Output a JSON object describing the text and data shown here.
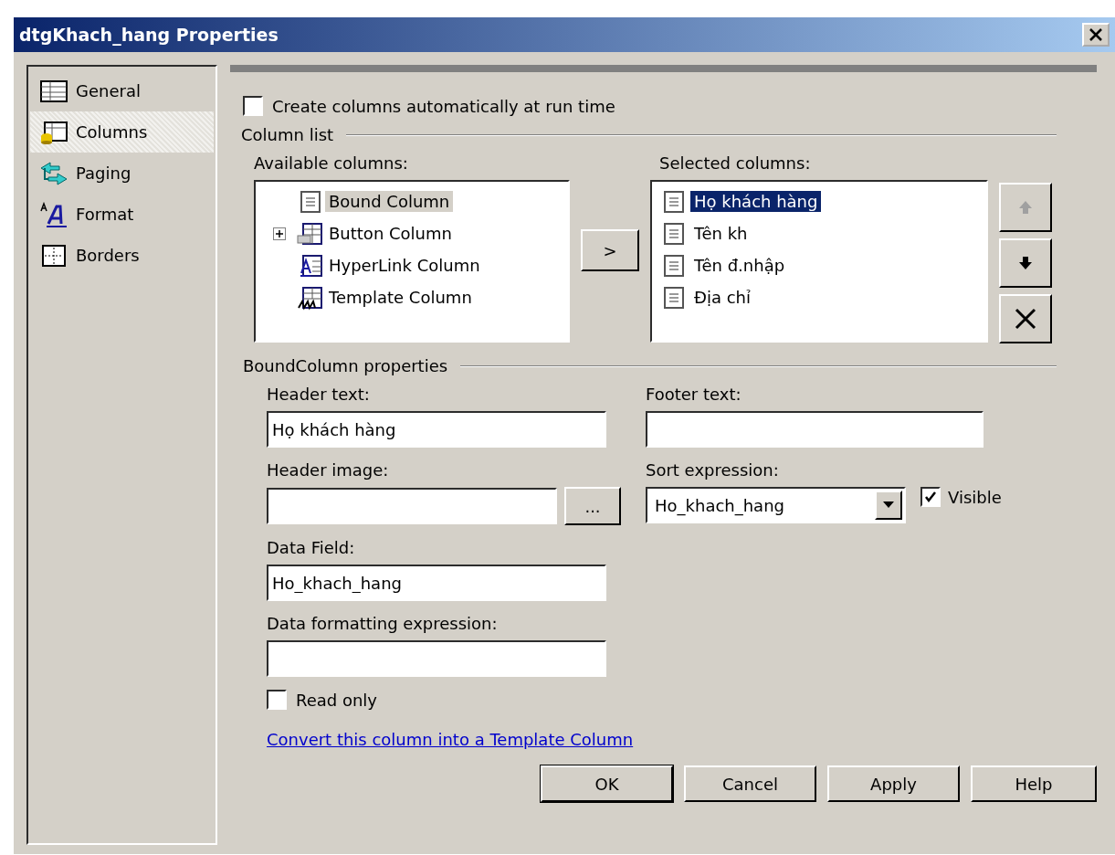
{
  "window": {
    "title": "dtgKhach_hang Properties"
  },
  "sidebar": {
    "items": [
      {
        "kind": "general",
        "label": "General",
        "selected": false
      },
      {
        "kind": "columns",
        "label": "Columns",
        "selected": true
      },
      {
        "kind": "paging",
        "label": "Paging",
        "selected": false
      },
      {
        "kind": "format",
        "label": "Format",
        "selected": false
      },
      {
        "kind": "borders",
        "label": "Borders",
        "selected": false
      }
    ]
  },
  "auto_columns": {
    "label": "Create columns automatically at run time",
    "checked": false
  },
  "column_list": {
    "title": "Column list",
    "available": {
      "label": "Available columns:",
      "items": [
        {
          "kind": "bound",
          "label": "Bound Column",
          "selected": true
        },
        {
          "kind": "button",
          "label": "Button Column",
          "selected": false,
          "expanded": false
        },
        {
          "kind": "hyperlink",
          "label": "HyperLink Column",
          "selected": false
        },
        {
          "kind": "template",
          "label": "Template Column",
          "selected": false
        }
      ]
    },
    "add_button": ">",
    "selected": {
      "label": "Selected columns:",
      "items": [
        {
          "label": "Họ khách hàng",
          "selected": true
        },
        {
          "label": "Tên kh",
          "selected": false
        },
        {
          "label": "Tên đ.nhập",
          "selected": false
        },
        {
          "label": "Địa chỉ",
          "selected": false
        }
      ]
    },
    "move_buttons": [
      {
        "kind": "up",
        "disabled": true
      },
      {
        "kind": "down",
        "disabled": false
      },
      {
        "kind": "delete",
        "disabled": false
      }
    ]
  },
  "properties": {
    "title": "BoundColumn properties",
    "header_text": {
      "label": "Header text:",
      "value": "Họ khách hàng"
    },
    "footer_text": {
      "label": "Footer text:"
    },
    "header_image": {
      "label": "Header image:",
      "browse": "..."
    },
    "sort_expression": {
      "label": "Sort expression:",
      "value": "Ho_khach_hang"
    },
    "visible": {
      "label": "Visible",
      "checked": true
    },
    "data_field": {
      "label": "Data Field:",
      "value": "Ho_khach_hang"
    },
    "data_format": {
      "label": "Data formatting expression:"
    },
    "read_only": {
      "label": "Read only",
      "checked": false
    },
    "convert_link": "Convert this column into a Template Column"
  },
  "buttons": [
    {
      "label": "OK",
      "default": true
    },
    {
      "label": "Cancel",
      "default": false
    },
    {
      "label": "Apply",
      "default": false
    },
    {
      "label": "Help",
      "default": false
    }
  ]
}
